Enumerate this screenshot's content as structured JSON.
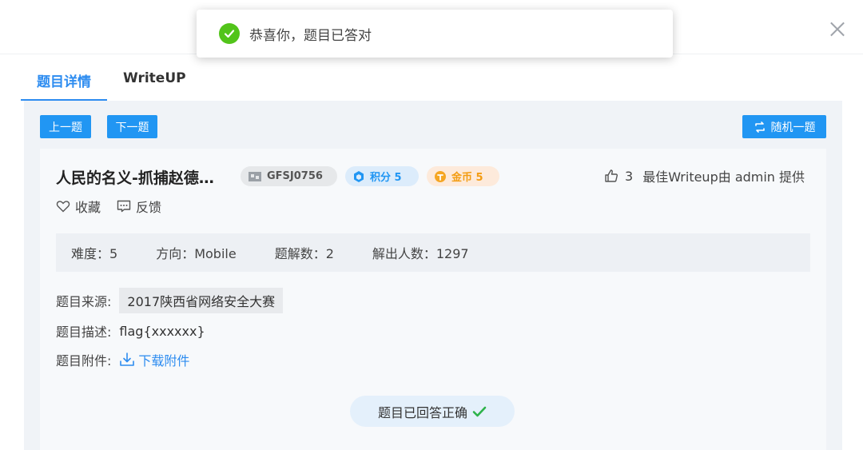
{
  "toast": {
    "message": "恭喜你，题目已答对",
    "icon": "check-circle-icon",
    "color": "#52c41a"
  },
  "tabs": [
    {
      "label": "题目详情",
      "active": true
    },
    {
      "label": "WriteUP",
      "active": false
    }
  ],
  "toolbar": {
    "prev_label": "上一题",
    "next_label": "下一题",
    "random_label": "随机一题"
  },
  "challenge": {
    "title": "人民的名义-抓捕赵德…",
    "id": "GFSJ0756",
    "score_label": "积分 5",
    "coin_label": "金币 5",
    "likes": "3",
    "best_writeup": "最佳Writeup由 admin 提供",
    "favorite_label": "收藏",
    "feedback_label": "反馈"
  },
  "stats": {
    "difficulty": "难度：5",
    "direction": "方向：Mobile",
    "writeups": "题解数：2",
    "solvers": "解出人数：1297"
  },
  "info": {
    "source_label": "题目来源:",
    "source_value": "2017陕西省网络安全大赛",
    "desc_label": "题目描述:",
    "desc_value": "flag{xxxxxx}",
    "attachment_label": "题目附件:",
    "download_label": "下载附件"
  },
  "status": {
    "answered_label": "题目已回答正确"
  },
  "colors": {
    "accent": "#2196f3",
    "success": "#52c41a",
    "coin": "#f39c12"
  }
}
